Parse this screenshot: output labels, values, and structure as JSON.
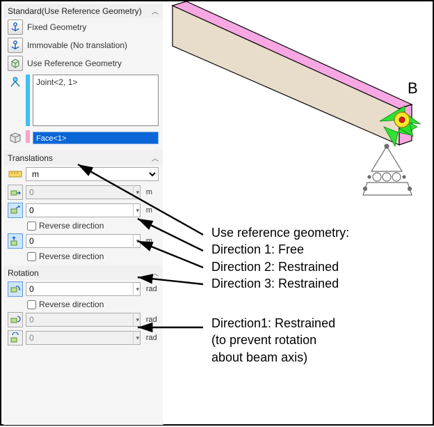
{
  "panel": {
    "header": "Standard(Use Reference Geometry)",
    "options": {
      "fixed": "Fixed Geometry",
      "immovable": "Immovable (No translation)",
      "useRef": "Use Reference Geometry"
    },
    "jointList": "Joint<2, 1>",
    "faceSel": "Face<1>",
    "translations": {
      "title": "Translations",
      "unit": "m",
      "d1": "0",
      "d2": "0",
      "d3": "0",
      "suffix": "m",
      "reverse": "Reverse direction"
    },
    "rotation": {
      "title": "Rotation",
      "d1": "0",
      "d2": "0",
      "d3": "0",
      "suffix": "rad",
      "reverse": "Reverse direction"
    }
  },
  "viewport": {
    "labelB": "B",
    "annot1_l1": "Use reference geometry:",
    "annot1_l2": "Direction 1: Free",
    "annot1_l3": "Direction 2: Restrained",
    "annot1_l4": "Direction 3: Restrained",
    "annot2_l1": "Direction1: Restrained",
    "annot2_l2": "(to prevent rotation",
    "annot2_l3": "about beam axis)"
  },
  "colors": {
    "beamTop": "#f7a8e2",
    "beamSide": "#e8dccb",
    "arrowGreen": "#28e22c",
    "jointYellow": "#f6e52c",
    "jointRed": "#d81e1e",
    "supportGray": "#6e6e6e"
  },
  "chart_data": null
}
